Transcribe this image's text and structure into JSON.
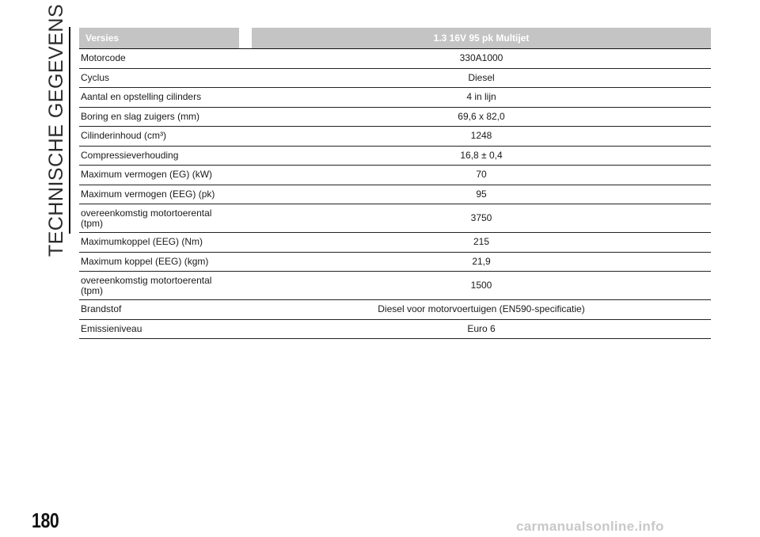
{
  "side_title": "TECHNISCHE GEGEVENS",
  "table": {
    "header": {
      "label": "Versies",
      "value": "1.3 16V 95 pk Multijet"
    },
    "rows": [
      {
        "label": "Motorcode",
        "value": "330A1000"
      },
      {
        "label": "Cyclus",
        "value": "Diesel"
      },
      {
        "label": "Aantal en opstelling cilinders",
        "value": "4 in lijn"
      },
      {
        "label": "Boring en slag zuigers (mm)",
        "value": "69,6 x 82,0"
      },
      {
        "label": "Cilinderinhoud (cm³)",
        "value": "1248"
      },
      {
        "label": "Compressieverhouding",
        "value": "16,8 ± 0,4"
      },
      {
        "label": "Maximum vermogen (EG) (kW)",
        "value": "70"
      },
      {
        "label": "Maximum vermogen (EEG) (pk)",
        "value": "95"
      },
      {
        "label_line1": "overeenkomstig motortoerental",
        "label_line2": "(tpm)",
        "value": "3750"
      },
      {
        "label": "Maximumkoppel (EEG) (Nm)",
        "value": "215"
      },
      {
        "label": "Maximum koppel (EEG) (kgm)",
        "value": "21,9"
      },
      {
        "label_line1": "overeenkomstig motortoerental",
        "label_line2": "(tpm)",
        "value": "1500"
      },
      {
        "label": "Brandstof",
        "value": "Diesel voor motorvoertuigen (EN590-specificatie)"
      },
      {
        "label": "Emissieniveau",
        "value": "Euro 6"
      }
    ]
  },
  "page_number": "180",
  "watermark": "carmanualsonline.info"
}
